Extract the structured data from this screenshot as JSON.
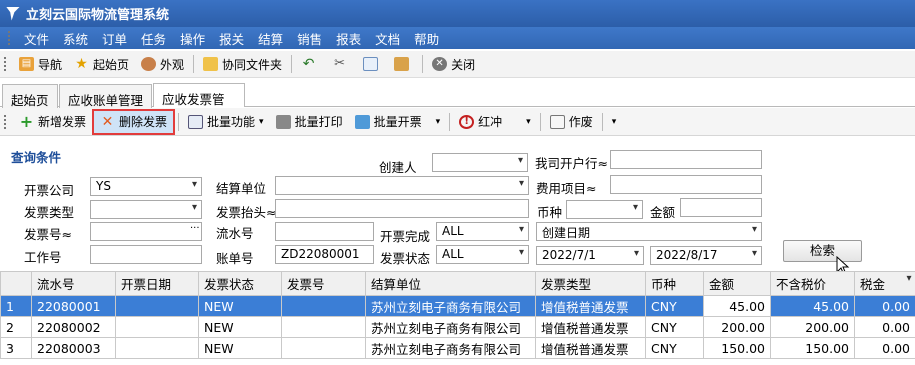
{
  "app": {
    "title": "立刻云国际物流管理系统"
  },
  "menu": [
    "文件",
    "系统",
    "订单",
    "任务",
    "操作",
    "报关",
    "结算",
    "销售",
    "报表",
    "文档",
    "帮助"
  ],
  "toolbar": {
    "nav": "导航",
    "home": "起始页",
    "appearance": "外观",
    "shared_folder": "协同文件夹",
    "close": "关闭"
  },
  "tabs": [
    "起始页",
    "应收账单管理",
    "应收发票管理"
  ],
  "actions": {
    "add": "新增发票",
    "delete": "删除发票",
    "batch_func": "批量功能",
    "batch_print": "批量打印",
    "batch_issue": "批量开票",
    "red": "红冲",
    "void": "作废"
  },
  "query": {
    "heading": "查询条件",
    "creator_label": "创建人",
    "creator_value": "",
    "bank_label": "我司开户行≈",
    "bank_value": "",
    "company_label": "开票公司",
    "company_value": "YS",
    "settle_label": "结算单位",
    "settle_value": "",
    "fee_label": "费用项目≈",
    "fee_value": "",
    "inv_type_label": "发票类型",
    "inv_type_value": "",
    "inv_header_label": "发票抬头≈",
    "inv_header_value": "",
    "currency_label": "币种",
    "currency_value": "",
    "amount_label": "金额",
    "amount_value": "",
    "inv_no_label": "发票号≈",
    "inv_no_value": "",
    "serial_label": "流水号",
    "serial_value": "",
    "done_label": "开票完成",
    "done_value": "ALL",
    "date_type_value": "创建日期",
    "job_label": "工作号",
    "job_value": "",
    "bill_label": "账单号",
    "bill_value": "ZD22080001",
    "status_label": "发票状态",
    "status_value": "ALL",
    "date_from": "2022/7/1",
    "date_to": "2022/8/17",
    "search_label": "检索"
  },
  "grid": {
    "columns": [
      "流水号",
      "开票日期",
      "发票状态",
      "发票号",
      "结算单位",
      "发票类型",
      "币种",
      "金额",
      "不含税价",
      "税金"
    ],
    "rows": [
      {
        "idx": "1",
        "serial": "22080001",
        "date": "",
        "status": "NEW",
        "inv_no": "",
        "unit": "苏州立刻电子商务有限公司",
        "type": "增值税普通发票",
        "cur": "CNY",
        "amount": "45.00",
        "net": "45.00",
        "tax": "0.00"
      },
      {
        "idx": "2",
        "serial": "22080002",
        "date": "",
        "status": "NEW",
        "inv_no": "",
        "unit": "苏州立刻电子商务有限公司",
        "type": "增值税普通发票",
        "cur": "CNY",
        "amount": "200.00",
        "net": "200.00",
        "tax": "0.00"
      },
      {
        "idx": "3",
        "serial": "22080003",
        "date": "",
        "status": "NEW",
        "inv_no": "",
        "unit": "苏州立刻电子商务有限公司",
        "type": "增值税普通发票",
        "cur": "CNY",
        "amount": "150.00",
        "net": "150.00",
        "tax": "0.00"
      }
    ]
  }
}
